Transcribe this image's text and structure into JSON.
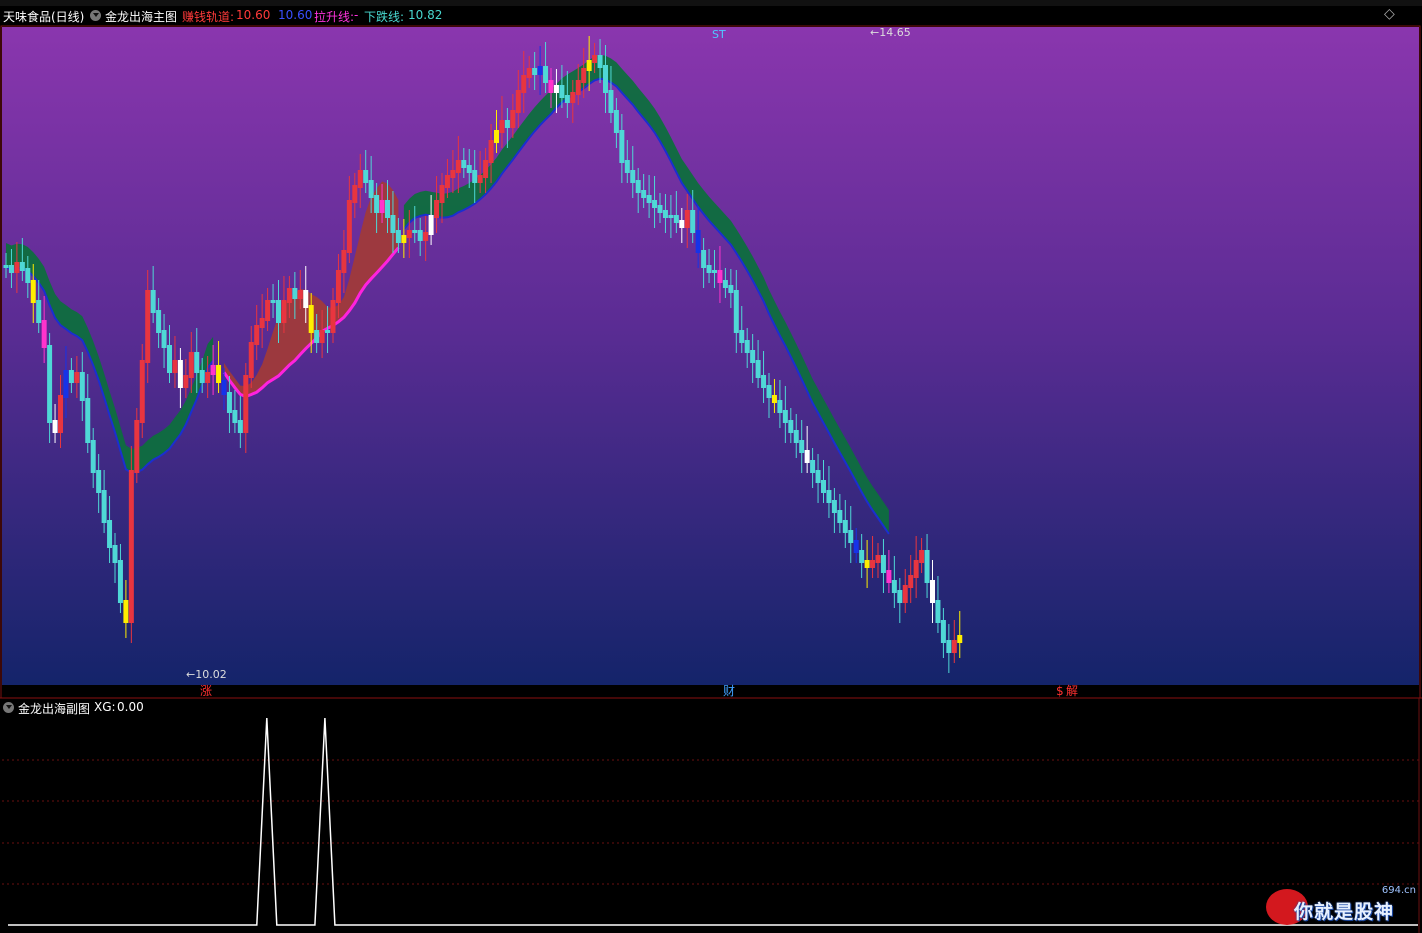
{
  "header": {
    "stock_title": "天味食品(日线)",
    "indicator_name": "金龙出海主图",
    "orbit_label": "赚钱轨道:",
    "orbit_value": "10.60",
    "orbit_value2": "10.60",
    "rise_label": "拉升线:",
    "rise_value": "-",
    "fall_label": "下跌线:",
    "fall_value": "10.82"
  },
  "sub_header": {
    "indicator_name": "金龙出海副图",
    "xg_label": "XG:",
    "xg_value": "0.00"
  },
  "chart_data": {
    "type": "candlestick",
    "title": "天味食品(日线)",
    "high_marker": "14.65",
    "low_marker": "10.02",
    "st_label": "ST",
    "event_markers": [
      {
        "label": "涨",
        "color": "#ff3030"
      },
      {
        "label": "财",
        "color": "#40a0ff"
      },
      {
        "label": "$",
        "color": "#ff3030"
      },
      {
        "label": "解",
        "color": "#ff3030"
      }
    ],
    "xg_signal_values": [
      0,
      0,
      0,
      0,
      0,
      0,
      0,
      0,
      0,
      0,
      0,
      0,
      0,
      0,
      0,
      0,
      0,
      0,
      0,
      0,
      0,
      0,
      0,
      0,
      0,
      0,
      0,
      0,
      0,
      0,
      0,
      0,
      0,
      0,
      0,
      0,
      0,
      0,
      0,
      0,
      0,
      0,
      0,
      0,
      0,
      0,
      0,
      0,
      0,
      1,
      0,
      0,
      0,
      0,
      0,
      0,
      0,
      0,
      0,
      0,
      1,
      0,
      0,
      0,
      0,
      0,
      0,
      0,
      0,
      0,
      0,
      0,
      0,
      0,
      0,
      0,
      0,
      0,
      0,
      0,
      0,
      0,
      0,
      0,
      0,
      0,
      0,
      0,
      0,
      0,
      0,
      0,
      0,
      0,
      0,
      0,
      0,
      0,
      0,
      0,
      0,
      0,
      0,
      0,
      0,
      0,
      0,
      0,
      0,
      0,
      0,
      0,
      0,
      0,
      0,
      0,
      0,
      0,
      0,
      0,
      0,
      0,
      0,
      0,
      0,
      0,
      0,
      0,
      0,
      0,
      0,
      0,
      0,
      0,
      0,
      0,
      0,
      0,
      0,
      0,
      0,
      0,
      0,
      0,
      0,
      0,
      0,
      0,
      0,
      0,
      0,
      0,
      0,
      0,
      0,
      0,
      0,
      0,
      0,
      0,
      0,
      0,
      0,
      0,
      0,
      0,
      0,
      0,
      0,
      0,
      0,
      0,
      0,
      0,
      0,
      0,
      0,
      0,
      0,
      0,
      0,
      0,
      0,
      0,
      0,
      0,
      0,
      0,
      0,
      0,
      0,
      0,
      0,
      0,
      0,
      0,
      0,
      0,
      0,
      0,
      0,
      0,
      0,
      0,
      0,
      0,
      0,
      0,
      0,
      0,
      0,
      0,
      0,
      0,
      0,
      0,
      0,
      0,
      0,
      0,
      0,
      0,
      0,
      0,
      0,
      0,
      0,
      0,
      0,
      0,
      0,
      0,
      0,
      0,
      0,
      0,
      0,
      0,
      0,
      0,
      0,
      0,
      0,
      0,
      0,
      0,
      0,
      0,
      0,
      0,
      0,
      0,
      0,
      0,
      0,
      0,
      0,
      0,
      0,
      0,
      0,
      0,
      0,
      0,
      0,
      0,
      0,
      0
    ],
    "colors": {
      "up": "#e8353f",
      "down": "#4fd8d6",
      "yellow": "#ffee00",
      "blue": "#1633e8",
      "magenta": "#ff33cc",
      "white": "#ffffff",
      "rise_band": "#a03a3a",
      "fall_band": "#0e6e3e",
      "rise_line": "#ff22dd",
      "fall_line": "#1a2fd0",
      "bg_top": "#8a36ae",
      "bg_bottom": "#14246a"
    }
  },
  "watermark": {
    "text": "你就是股神",
    "url": "694.cn"
  }
}
